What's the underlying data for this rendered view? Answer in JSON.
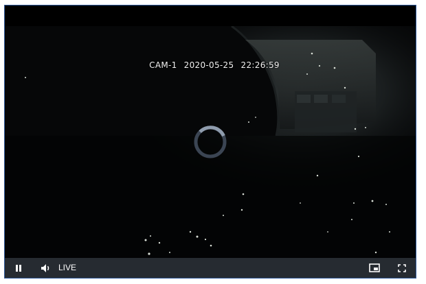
{
  "osd": {
    "camera": "CAM-1",
    "date": "2020-05-25",
    "time": "22:26:59"
  },
  "controls": {
    "live_label": "LIVE",
    "icons": [
      "pause-icon",
      "volume-icon",
      "picture-in-picture-icon",
      "fullscreen-icon"
    ]
  },
  "colors": {
    "control_bar": "#262b31",
    "spinner_track": "#3b4553",
    "spinner_arc": "#8f9cad",
    "player_border": "#2f5a9c"
  }
}
